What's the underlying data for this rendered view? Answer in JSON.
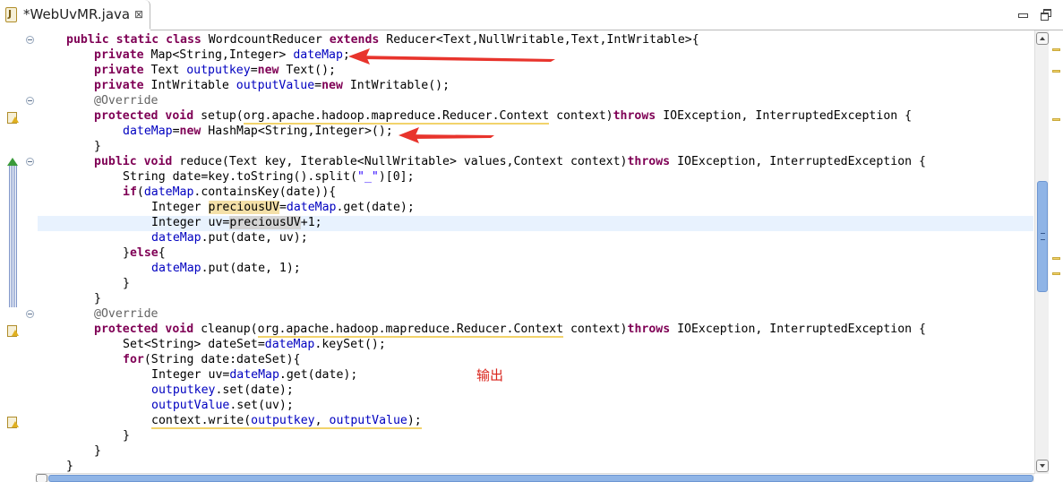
{
  "tab": {
    "title": "*WebUvMR.java",
    "close_glyph": "⊠"
  },
  "window": {
    "minimize_icon": "minimize-icon",
    "maximize_icon": "restore-icon"
  },
  "code": {
    "l1": {
      "a": "public static class ",
      "b": "WordcountReducer ",
      "c": "extends",
      "d": " Reducer<Text,NullWritable,Text,IntWritable>{"
    },
    "l2": {
      "a": "private",
      "b": " Map<String,Integer> ",
      "c": "dateMap",
      "d": ";"
    },
    "l3": {
      "a": "private",
      "b": " Text ",
      "c": "outputkey",
      "d": "=",
      "e": "new",
      "f": " Text();"
    },
    "l4": {
      "a": "private",
      "b": " IntWritable ",
      "c": "outputValue",
      "d": "=",
      "e": "new",
      "f": " IntWritable();"
    },
    "l5": {
      "a": "@Override"
    },
    "l6": {
      "a": "protected void",
      "b": " setup(",
      "c": "org.apache.hadoop.mapreduce.Reducer.Context",
      "d": " context)",
      "e": "throws",
      "f": " IOException, InterruptedException {"
    },
    "l7": {
      "a": "dateMap",
      "b": "=",
      "c": "new",
      "d": " HashMap<String,Integer>();"
    },
    "l8": {
      "a": "}"
    },
    "l9": {
      "a": "public void",
      "b": " reduce(Text key, Iterable<NullWritable> values,Context context)",
      "c": "throws",
      "d": " IOException, InterruptedException {"
    },
    "l10": {
      "a": "String date=key.toString().split(",
      "b": "\"_\"",
      "c": ")[0];"
    },
    "l11": {
      "a": "if",
      "b": "(",
      "c": "dateMap",
      "d": ".containsKey(date)){"
    },
    "l12": {
      "a": "Integer ",
      "b": "preciousUV",
      "c": "=",
      "d": "dateMap",
      "e": ".get(date);"
    },
    "l13": {
      "a": "Integer uv=",
      "b": "preciousUV",
      "c": "+1;"
    },
    "l14": {
      "a": "dateMap",
      "b": ".put(date, uv);"
    },
    "l15": {
      "a": "}",
      "b": "else",
      "c": "{"
    },
    "l16": {
      "a": "dateMap",
      "b": ".put(date, 1);"
    },
    "l17": {
      "a": "}"
    },
    "l18": {
      "a": "}"
    },
    "l19": {
      "a": "@Override"
    },
    "l20": {
      "a": "protected void",
      "b": " cleanup(",
      "c": "org.apache.hadoop.mapreduce.Reducer.Context",
      "d": " context)",
      "e": "throws",
      "f": " IOException, InterruptedException {"
    },
    "l21": {
      "a": "Set<String> dateSet=",
      "b": "dateMap",
      "c": ".keySet();"
    },
    "l22": {
      "a": "for",
      "b": "(String date:dateSet){"
    },
    "l23": {
      "a": "Integer uv=",
      "b": "dateMap",
      "c": ".get(date);"
    },
    "l24": {
      "a": "outputkey",
      "b": ".set(date);"
    },
    "l25": {
      "a": "outputValue",
      "b": ".set(uv);"
    },
    "l26": {
      "a": "context.write(",
      "b": "outputkey",
      "c": ", ",
      "d": "outputValue",
      "e": ");"
    },
    "l27": {
      "a": "}"
    },
    "l28": {
      "a": "}"
    },
    "l29": {
      "a": "}"
    }
  },
  "annotation": {
    "text": "输出",
    "arrow_color": "#e8342c"
  },
  "colors": {
    "keyword": "#7f0055",
    "field": "#0000c0",
    "annotation": "#646464",
    "string": "#2a00ff",
    "warning": "#f2d36b",
    "current_line": "#e8f2fe"
  }
}
